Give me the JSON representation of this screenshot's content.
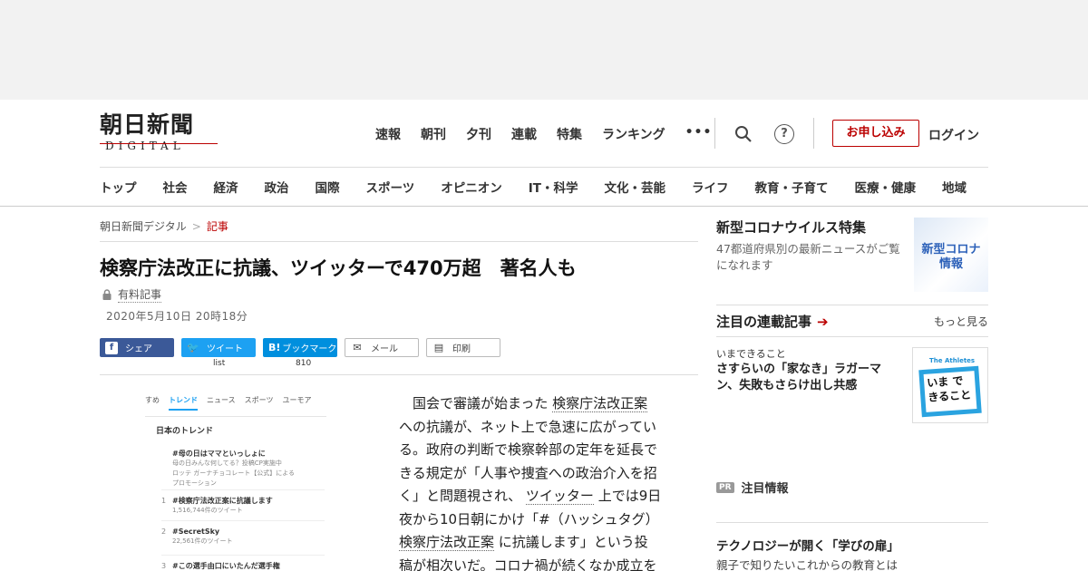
{
  "header": {
    "logo_main": "朝日新聞",
    "logo_sub": "DIGITAL",
    "topnav": [
      "速報",
      "朝刊",
      "夕刊",
      "連載",
      "特集",
      "ランキング"
    ],
    "more_label": "•••",
    "help_label": "?",
    "subscribe_label": "お申し込み",
    "login_label": "ログイン",
    "accent_color": "#b00000"
  },
  "catnav": [
    "トップ",
    "社会",
    "経済",
    "政治",
    "国際",
    "スポーツ",
    "オピニオン",
    "IT・科学",
    "文化・芸能",
    "ライフ",
    "教育・子育て",
    "医療・健康",
    "地域"
  ],
  "breadcrumb": {
    "home": "朝日新聞デジタル",
    "sep": ">",
    "current": "記事"
  },
  "article": {
    "title": "検察庁法改正に抗議、ツイッターで470万超　著名人も",
    "paid_label": "有料記事",
    "date": "2020年5月10日 20時18分",
    "share": {
      "facebook_icon": "f",
      "facebook": "シェア",
      "twitter_icon": "🐦",
      "twitter": "ツイート",
      "twitter_count": "list",
      "hatena_icon": "B!",
      "hatena": "ブックマーク",
      "hatena_count": "810",
      "mail_icon": "✉",
      "mail": "メール",
      "print_icon": "▤",
      "print": "印刷"
    },
    "body_lines": [
      {
        "pre": "　国会で審議が始まった ",
        "link": "検察庁法改正案",
        "post": ""
      },
      {
        "pre": "への抗議が、ネット上で急速に広がってい",
        "link": "",
        "post": ""
      },
      {
        "pre": "る。政府の判断で検察幹部の定年を延長で",
        "link": "",
        "post": ""
      },
      {
        "pre": "きる規定が「人事や捜査への政治介入を招",
        "link": "",
        "post": ""
      },
      {
        "pre": "く」と問題視され、 ",
        "link": "ツイッター",
        "post": " 上では9日"
      },
      {
        "pre": "夜から10日朝にかけ「#（ハッシュタグ）",
        "link": "",
        "post": ""
      },
      {
        "pre": " ",
        "link": "検察庁法改正案",
        "post": " に抗議します」という投"
      },
      {
        "pre": "稿が相次いだ。コロナ禍が続くなか成立を",
        "link": "",
        "post": ""
      }
    ]
  },
  "twitter_shot": {
    "tabs": [
      "すめ",
      "トレンド",
      "ニュース",
      "スポーツ",
      "ユーモア"
    ],
    "active_tab": "トレンド",
    "heading": "日本のトレンド",
    "promo_title": "#母の日はママといっしょに",
    "promo_line1": "母の日みんな何してる？投稿CP実施中",
    "promo_line2": "ロッテ ガーナチョコレート【公式】による",
    "promo_line3": "プロモーション",
    "items": [
      {
        "n": "1",
        "t": "#検察庁法改正案に抗議します",
        "c": "1,516,744件のツイート"
      },
      {
        "n": "2",
        "t": "#SecretSky",
        "c": "22,561件のツイート"
      },
      {
        "n": "3",
        "t": "#この選手由口にいたんだ選手権",
        "c": ""
      }
    ]
  },
  "sidebar": {
    "corona_title": "新型コロナウイルス特集",
    "corona_desc": "47都道府県別の最新ニュースがご覧になれます",
    "corona_thumb": "新型コロナ情報",
    "serial_title": "注目の連載記事",
    "serial_arrow": "➔",
    "more_label": "もっと見る",
    "serial_kicker": "いまできること",
    "serial_text": "さすらいの「家なき」ラガーマン、失敗もさらけ出し共感",
    "serial_thumb_small": "The Athletes",
    "serial_thumb_big": "いま できること",
    "pr_badge": "PR",
    "pr_label": "注目情報",
    "tech_title": "テクノロジーが開く「学びの扉」",
    "tech_sub": "親子で知りたいこれからの教育とは"
  }
}
